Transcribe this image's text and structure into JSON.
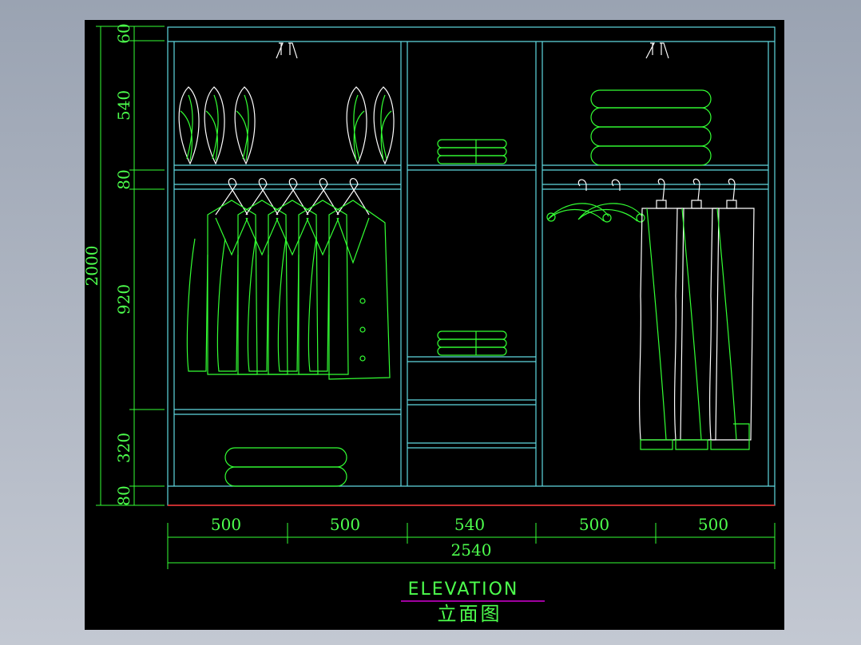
{
  "drawing": {
    "title_en": "ELEVATION",
    "title_cn": "立面图",
    "overall_height": "2000",
    "overall_width": "2540"
  },
  "vertical_dims": [
    "60",
    "540",
    "80",
    "920",
    "320",
    "80"
  ],
  "horizontal_dims": [
    "500",
    "500",
    "540",
    "500",
    "500"
  ],
  "colors": {
    "background": "#000000",
    "cabinet_lines": "#5fd8e0",
    "content_lines": "#33ff33",
    "highlight_lines": "#ffffff",
    "title_text": "#4dff4d",
    "underline": "#ff00ff",
    "floor_line": "#ff3030"
  }
}
